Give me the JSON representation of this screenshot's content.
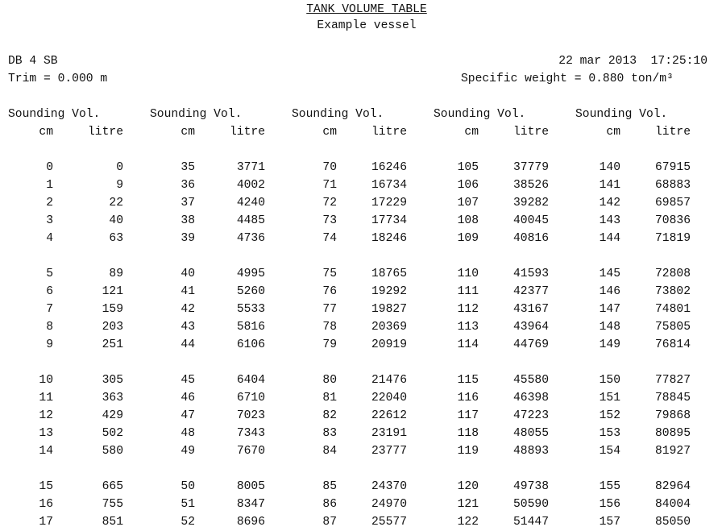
{
  "header": {
    "title": "TANK VOLUME TABLE",
    "subtitle": "Example vessel",
    "tank": "DB 4 SB",
    "trim": "Trim = 0.000 m",
    "datetime": "22 mar 2013  17:25:10",
    "specific_weight": "Specific weight = 0.880 ton/m³"
  },
  "table": {
    "col_header_1": "Sounding Vol.",
    "unit_sounding": "cm",
    "unit_volume": "litre",
    "blocks": [
      {
        "rows": [
          [
            0,
            0
          ],
          [
            1,
            9
          ],
          [
            2,
            22
          ],
          [
            3,
            40
          ],
          [
            4,
            63
          ],
          [
            5,
            89
          ],
          [
            6,
            121
          ],
          [
            7,
            159
          ],
          [
            8,
            203
          ],
          [
            9,
            251
          ],
          [
            10,
            305
          ],
          [
            11,
            363
          ],
          [
            12,
            429
          ],
          [
            13,
            502
          ],
          [
            14,
            580
          ],
          [
            15,
            665
          ],
          [
            16,
            755
          ],
          [
            17,
            851
          ]
        ]
      },
      {
        "rows": [
          [
            35,
            3771
          ],
          [
            36,
            4002
          ],
          [
            37,
            4240
          ],
          [
            38,
            4485
          ],
          [
            39,
            4736
          ],
          [
            40,
            4995
          ],
          [
            41,
            5260
          ],
          [
            42,
            5533
          ],
          [
            43,
            5816
          ],
          [
            44,
            6106
          ],
          [
            45,
            6404
          ],
          [
            46,
            6710
          ],
          [
            47,
            7023
          ],
          [
            48,
            7343
          ],
          [
            49,
            7670
          ],
          [
            50,
            8005
          ],
          [
            51,
            8347
          ],
          [
            52,
            8696
          ]
        ]
      },
      {
        "rows": [
          [
            70,
            16246
          ],
          [
            71,
            16734
          ],
          [
            72,
            17229
          ],
          [
            73,
            17734
          ],
          [
            74,
            18246
          ],
          [
            75,
            18765
          ],
          [
            76,
            19292
          ],
          [
            77,
            19827
          ],
          [
            78,
            20369
          ],
          [
            79,
            20919
          ],
          [
            80,
            21476
          ],
          [
            81,
            22040
          ],
          [
            82,
            22612
          ],
          [
            83,
            23191
          ],
          [
            84,
            23777
          ],
          [
            85,
            24370
          ],
          [
            86,
            24970
          ],
          [
            87,
            25577
          ]
        ]
      },
      {
        "rows": [
          [
            105,
            37779
          ],
          [
            106,
            38526
          ],
          [
            107,
            39282
          ],
          [
            108,
            40045
          ],
          [
            109,
            40816
          ],
          [
            110,
            41593
          ],
          [
            111,
            42377
          ],
          [
            112,
            43167
          ],
          [
            113,
            43964
          ],
          [
            114,
            44769
          ],
          [
            115,
            45580
          ],
          [
            116,
            46398
          ],
          [
            117,
            47223
          ],
          [
            118,
            48055
          ],
          [
            119,
            48893
          ],
          [
            120,
            49738
          ],
          [
            121,
            50590
          ],
          [
            122,
            51447
          ]
        ]
      },
      {
        "rows": [
          [
            140,
            67915
          ],
          [
            141,
            68883
          ],
          [
            142,
            69857
          ],
          [
            143,
            70836
          ],
          [
            144,
            71819
          ],
          [
            145,
            72808
          ],
          [
            146,
            73802
          ],
          [
            147,
            74801
          ],
          [
            148,
            75805
          ],
          [
            149,
            76814
          ],
          [
            150,
            77827
          ],
          [
            151,
            78845
          ],
          [
            152,
            79868
          ],
          [
            153,
            80895
          ],
          [
            154,
            81927
          ],
          [
            155,
            82964
          ],
          [
            156,
            84004
          ],
          [
            157,
            85050
          ]
        ]
      }
    ]
  }
}
